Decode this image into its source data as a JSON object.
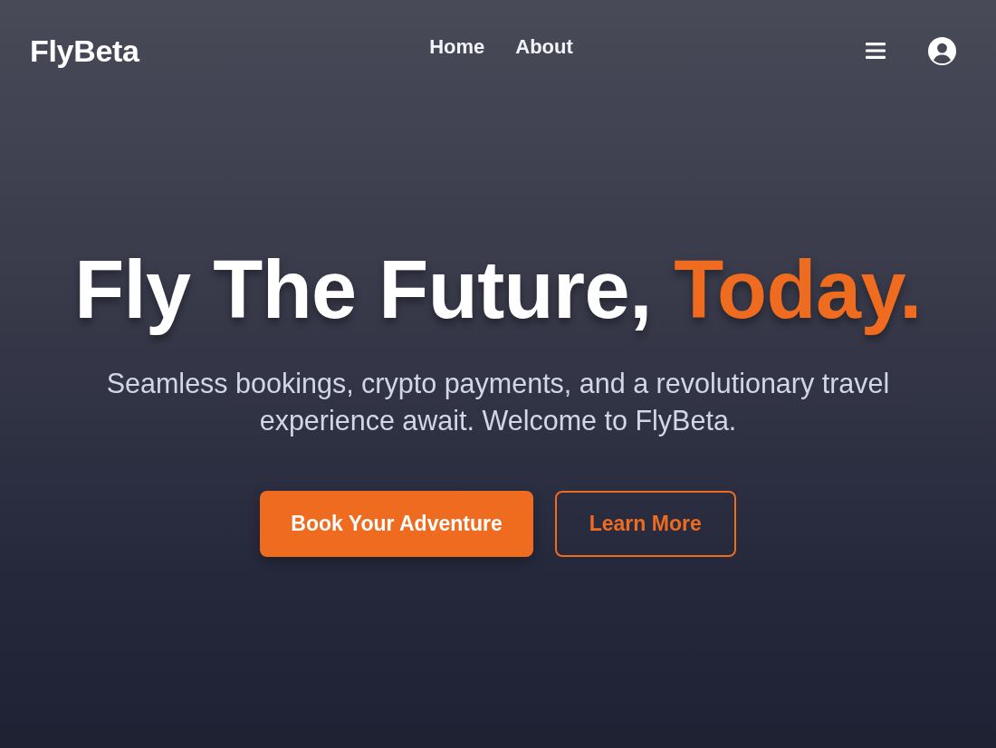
{
  "nav": {
    "logo": "FlyBeta",
    "links": [
      {
        "label": "Home"
      },
      {
        "label": "About"
      }
    ]
  },
  "hero": {
    "headline": "Fly The Future,",
    "headline_highlight": "Today.",
    "subtitle": "Seamless bookings, crypto payments, and a revolutionary travel experience await. Welcome to FlyBeta.",
    "buttons": [
      {
        "label": "Book Your Adventure",
        "kind": "primary"
      },
      {
        "label": "Learn More",
        "kind": "outline"
      }
    ]
  }
}
